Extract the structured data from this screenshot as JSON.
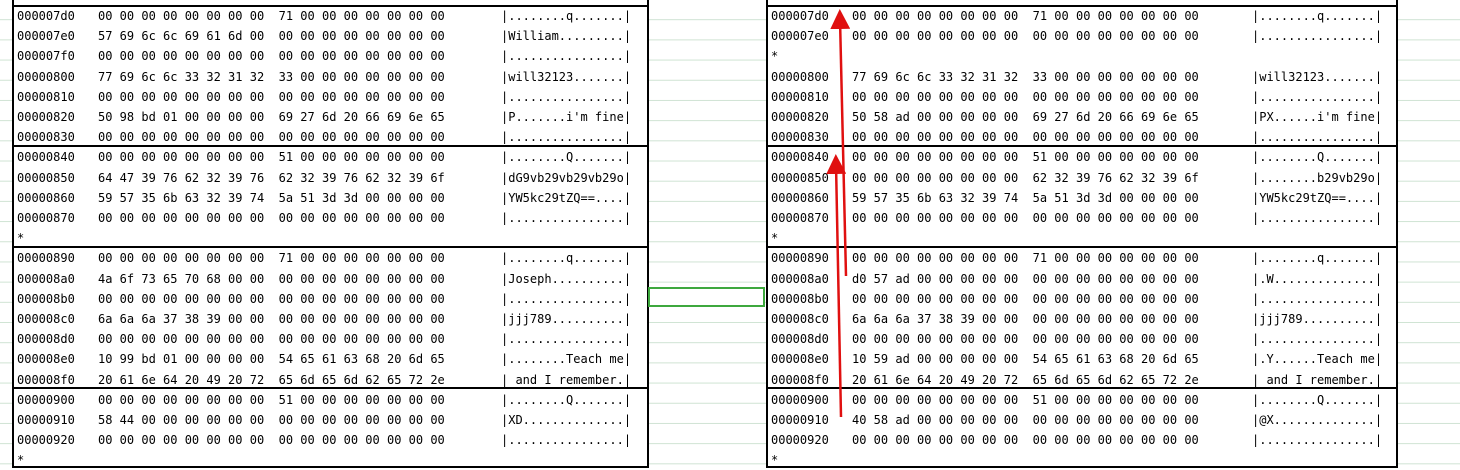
{
  "left_panel": {
    "lines": [
      {
        "addr": "000007d0",
        "hex": "00 00 00 00 00 00 00 00  71 00 00 00 00 00 00 00",
        "ascii": "|........q.......|"
      },
      {
        "addr": "000007e0",
        "hex": "57 69 6c 6c 69 61 6d 00  00 00 00 00 00 00 00 00",
        "ascii": "|William.........|"
      },
      {
        "addr": "000007f0",
        "hex": "00 00 00 00 00 00 00 00  00 00 00 00 00 00 00 00",
        "ascii": "|................|"
      },
      {
        "addr": "00000800",
        "hex": "77 69 6c 6c 33 32 31 32  33 00 00 00 00 00 00 00",
        "ascii": "|will32123.......|"
      },
      {
        "addr": "00000810",
        "hex": "00 00 00 00 00 00 00 00  00 00 00 00 00 00 00 00",
        "ascii": "|................|"
      },
      {
        "addr": "00000820",
        "hex": "50 98 bd 01 00 00 00 00  69 27 6d 20 66 69 6e 65",
        "ascii": "|P.......i'm fine|"
      },
      {
        "addr": "00000830",
        "hex": "00 00 00 00 00 00 00 00  00 00 00 00 00 00 00 00",
        "ascii": "|................|"
      },
      {
        "addr": "00000840",
        "hex": "00 00 00 00 00 00 00 00  51 00 00 00 00 00 00 00",
        "ascii": "|........Q.......|"
      },
      {
        "addr": "00000850",
        "hex": "64 47 39 76 62 32 39 76  62 32 39 76 62 32 39 6f",
        "ascii": "|dG9vb29vb29vb29o|"
      },
      {
        "addr": "00000860",
        "hex": "59 57 35 6b 63 32 39 74  5a 51 3d 3d 00 00 00 00",
        "ascii": "|YW5kc29tZQ==....|"
      },
      {
        "addr": "00000870",
        "hex": "00 00 00 00 00 00 00 00  00 00 00 00 00 00 00 00",
        "ascii": "|................|"
      },
      {
        "addr": "*",
        "hex": "",
        "ascii": ""
      },
      {
        "addr": "00000890",
        "hex": "00 00 00 00 00 00 00 00  71 00 00 00 00 00 00 00",
        "ascii": "|........q.......|"
      },
      {
        "addr": "000008a0",
        "hex": "4a 6f 73 65 70 68 00 00  00 00 00 00 00 00 00 00",
        "ascii": "|Joseph..........|"
      },
      {
        "addr": "000008b0",
        "hex": "00 00 00 00 00 00 00 00  00 00 00 00 00 00 00 00",
        "ascii": "|................|"
      },
      {
        "addr": "000008c0",
        "hex": "6a 6a 6a 37 38 39 00 00  00 00 00 00 00 00 00 00",
        "ascii": "|jjj789..........|"
      },
      {
        "addr": "000008d0",
        "hex": "00 00 00 00 00 00 00 00  00 00 00 00 00 00 00 00",
        "ascii": "|................|"
      },
      {
        "addr": "000008e0",
        "hex": "10 99 bd 01 00 00 00 00  54 65 61 63 68 20 6d 65",
        "ascii": "|........Teach me|"
      },
      {
        "addr": "000008f0",
        "hex": "20 61 6e 64 20 49 20 72  65 6d 65 6d 62 65 72 2e",
        "ascii": "| and I remember.|"
      },
      {
        "addr": "00000900",
        "hex": "00 00 00 00 00 00 00 00  51 00 00 00 00 00 00 00",
        "ascii": "|........Q.......|"
      },
      {
        "addr": "00000910",
        "hex": "58 44 00 00 00 00 00 00  00 00 00 00 00 00 00 00",
        "ascii": "|XD..............|"
      },
      {
        "addr": "00000920",
        "hex": "00 00 00 00 00 00 00 00  00 00 00 00 00 00 00 00",
        "ascii": "|................|"
      },
      {
        "addr": "*",
        "hex": "",
        "ascii": ""
      }
    ]
  },
  "right_panel": {
    "lines": [
      {
        "addr": "000007d0",
        "hex": "00 00 00 00 00 00 00 00  71 00 00 00 00 00 00 00",
        "ascii": "|........q.......|"
      },
      {
        "addr": "000007e0",
        "hex": "00 00 00 00 00 00 00 00  00 00 00 00 00 00 00 00",
        "ascii": "|................|"
      },
      {
        "addr": "*",
        "hex": "",
        "ascii": ""
      },
      {
        "addr": "00000800",
        "hex": "77 69 6c 6c 33 32 31 32  33 00 00 00 00 00 00 00",
        "ascii": "|will32123.......|"
      },
      {
        "addr": "00000810",
        "hex": "00 00 00 00 00 00 00 00  00 00 00 00 00 00 00 00",
        "ascii": "|................|"
      },
      {
        "addr": "00000820",
        "hex": "50 58 ad 00 00 00 00 00  69 27 6d 20 66 69 6e 65",
        "ascii": "|PX......i'm fine|"
      },
      {
        "addr": "00000830",
        "hex": "00 00 00 00 00 00 00 00  00 00 00 00 00 00 00 00",
        "ascii": "|................|"
      },
      {
        "addr": "00000840",
        "hex": "00 00 00 00 00 00 00 00  51 00 00 00 00 00 00 00",
        "ascii": "|........Q.......|"
      },
      {
        "addr": "00000850",
        "hex": "00 00 00 00 00 00 00 00  62 32 39 76 62 32 39 6f",
        "ascii": "|........b29vb29o|"
      },
      {
        "addr": "00000860",
        "hex": "59 57 35 6b 63 32 39 74  5a 51 3d 3d 00 00 00 00",
        "ascii": "|YW5kc29tZQ==....|"
      },
      {
        "addr": "00000870",
        "hex": "00 00 00 00 00 00 00 00  00 00 00 00 00 00 00 00",
        "ascii": "|................|"
      },
      {
        "addr": "*",
        "hex": "",
        "ascii": ""
      },
      {
        "addr": "00000890",
        "hex": "00 00 00 00 00 00 00 00  71 00 00 00 00 00 00 00",
        "ascii": "|........q.......|"
      },
      {
        "addr": "000008a0",
        "hex": "d0 57 ad 00 00 00 00 00  00 00 00 00 00 00 00 00",
        "ascii": "|.W..............|"
      },
      {
        "addr": "000008b0",
        "hex": "00 00 00 00 00 00 00 00  00 00 00 00 00 00 00 00",
        "ascii": "|................|"
      },
      {
        "addr": "000008c0",
        "hex": "6a 6a 6a 37 38 39 00 00  00 00 00 00 00 00 00 00",
        "ascii": "|jjj789..........|"
      },
      {
        "addr": "000008d0",
        "hex": "00 00 00 00 00 00 00 00  00 00 00 00 00 00 00 00",
        "ascii": "|................|"
      },
      {
        "addr": "000008e0",
        "hex": "10 59 ad 00 00 00 00 00  54 65 61 63 68 20 6d 65",
        "ascii": "|.Y......Teach me|"
      },
      {
        "addr": "000008f0",
        "hex": "20 61 6e 64 20 49 20 72  65 6d 65 6d 62 65 72 2e",
        "ascii": "| and I remember.|"
      },
      {
        "addr": "00000900",
        "hex": "00 00 00 00 00 00 00 00  51 00 00 00 00 00 00 00",
        "ascii": "|........Q.......|"
      },
      {
        "addr": "00000910",
        "hex": "40 58 ad 00 00 00 00 00  00 00 00 00 00 00 00 00",
        "ascii": "|@X..............|"
      },
      {
        "addr": "00000920",
        "hex": "00 00 00 00 00 00 00 00  00 00 00 00 00 00 00 00",
        "ascii": "|................|"
      },
      {
        "addr": "*",
        "hex": "",
        "ascii": ""
      }
    ]
  },
  "colors": {
    "arrow": "#e01010",
    "selection": "#3da83d",
    "grid": "#cfe3d3"
  }
}
